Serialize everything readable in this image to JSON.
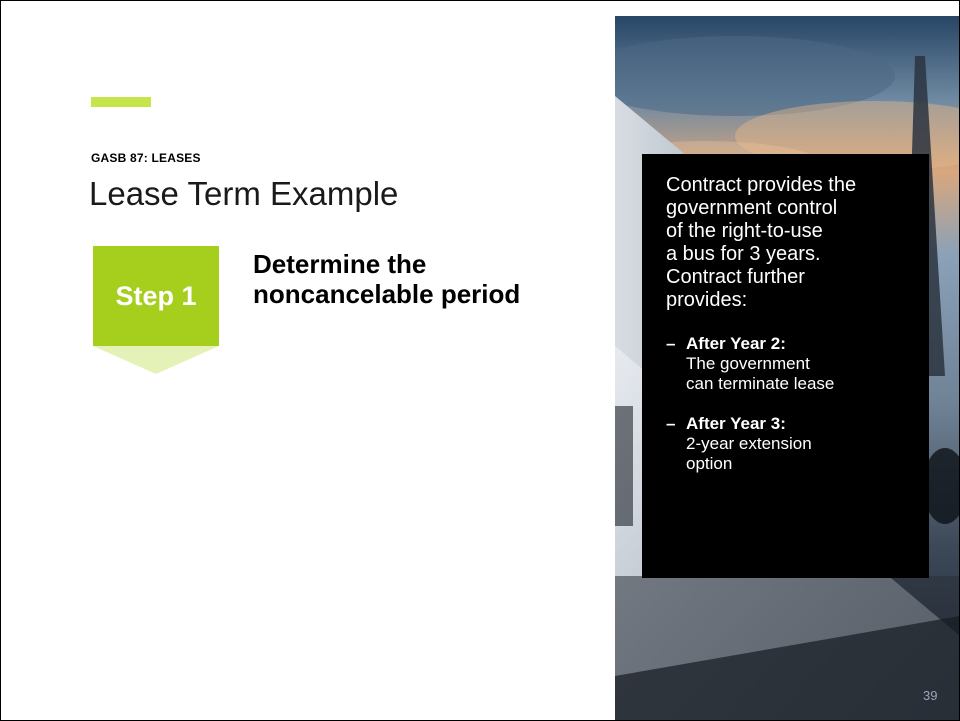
{
  "slide": {
    "eyebrow": "GASB 87: LEASES",
    "title": "Lease Term Example",
    "step": {
      "label": "Step 1",
      "heading_lines": [
        "Determine the",
        "noncancelable period"
      ]
    },
    "info": {
      "intro_lines": [
        "Contract provides the",
        "government control",
        "of the right-to-use",
        "a bus for 3 years.",
        "Contract further",
        "provides:"
      ],
      "items": [
        {
          "dash": "–",
          "heading": "After Year 2:",
          "lines": [
            "The government",
            "can terminate lease"
          ]
        },
        {
          "dash": "–",
          "heading": "After Year 3:",
          "lines": [
            "2-year extension",
            "option"
          ]
        }
      ]
    },
    "page_number": "39"
  },
  "colors": {
    "accent": "#c6e54a",
    "step_green": "#a6ce1d",
    "step_arrow": "#e4f2b8",
    "info_bg": "#000000"
  }
}
